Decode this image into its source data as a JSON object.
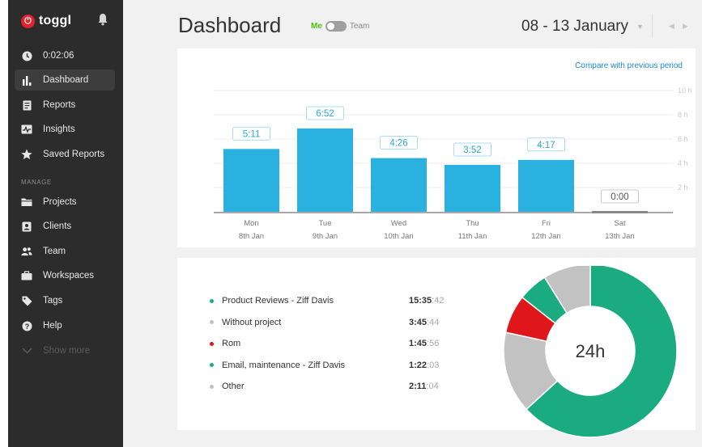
{
  "app": {
    "logo_text": "toggl",
    "timer": "0:02:06"
  },
  "sidebar": {
    "items": [
      {
        "label": "Dashboard",
        "icon": "bar-chart-icon",
        "active": true
      },
      {
        "label": "Reports",
        "icon": "report-icon"
      },
      {
        "label": "Insights",
        "icon": "insights-icon"
      },
      {
        "label": "Saved Reports",
        "icon": "star-icon"
      }
    ],
    "section_label": "MANAGE",
    "manage_items": [
      {
        "label": "Projects",
        "icon": "folder-icon"
      },
      {
        "label": "Clients",
        "icon": "client-icon"
      },
      {
        "label": "Team",
        "icon": "team-icon"
      },
      {
        "label": "Workspaces",
        "icon": "briefcase-icon"
      },
      {
        "label": "Tags",
        "icon": "tag-icon"
      },
      {
        "label": "Help",
        "icon": "help-icon"
      }
    ],
    "show_more": "Show more"
  },
  "header": {
    "title": "Dashboard",
    "toggle_me": "Me",
    "toggle_team": "Team",
    "date_range": "08 - 13 January"
  },
  "bar_card": {
    "compare_link": "Compare with previous period"
  },
  "chart_data": {
    "type": "bar",
    "categories": [
      "Mon",
      "Tue",
      "Wed",
      "Thu",
      "Fri",
      "Sat"
    ],
    "sublabels": [
      "8th Jan",
      "9th Jan",
      "10th Jan",
      "11th Jan",
      "12th Jan",
      "13th Jan"
    ],
    "values": [
      5.18,
      6.87,
      4.43,
      3.87,
      4.28,
      0
    ],
    "data_labels": [
      "5:11",
      "6:52",
      "4:26",
      "3:52",
      "4:17",
      "0:00"
    ],
    "yticks": [
      "10 h",
      "8 h",
      "6 h",
      "4 h",
      "2 h"
    ],
    "ylim": [
      0,
      10
    ],
    "bar_color": "#2bb1e0",
    "grid": true
  },
  "summary": {
    "items": [
      {
        "name": "Product Reviews - Ziff Davis",
        "time": "15:35",
        "sec": ":42",
        "color": "#1aab80",
        "hours": 15.59
      },
      {
        "name": "Without project",
        "time": "3:45",
        "sec": ":44",
        "color": "#c2c2c2",
        "hours": 3.76
      },
      {
        "name": "Rom",
        "time": "1:45",
        "sec": ":56",
        "color": "#e0171a",
        "hours": 1.77
      },
      {
        "name": "Email, maintenance - Ziff Davis",
        "time": "1:22",
        "sec": ":03",
        "color": "#1aab80",
        "hours": 1.37
      },
      {
        "name": "Other",
        "time": "2:11",
        "sec": ":04",
        "color": "#c2c2c2",
        "hours": 2.18
      }
    ],
    "total": "24h"
  }
}
